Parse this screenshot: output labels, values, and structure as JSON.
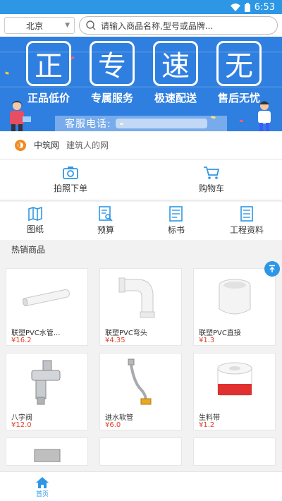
{
  "status": {
    "time": "6:53"
  },
  "search": {
    "city": "北京",
    "placeholder": "请输入商品名称,型号或品牌..."
  },
  "banner": {
    "badges": [
      {
        "char": "正",
        "caption": "正品低价"
      },
      {
        "char": "专",
        "caption": "专属服务"
      },
      {
        "char": "速",
        "caption": "极速配送"
      },
      {
        "char": "无",
        "caption": "售后无忧"
      }
    ],
    "service_label": "客服电话:"
  },
  "brand": {
    "name": "中筑网",
    "slogan": "建筑人的网"
  },
  "actions": [
    {
      "label": "拍照下单"
    },
    {
      "label": "购物车"
    }
  ],
  "nav": [
    {
      "label": "图纸"
    },
    {
      "label": "预算"
    },
    {
      "label": "标书"
    },
    {
      "label": "工程资料"
    }
  ],
  "section": {
    "title": "热销商品"
  },
  "products": [
    {
      "title": "联塑PVC水管...",
      "price": "¥16.2"
    },
    {
      "title": "联塑PVC弯头",
      "price": "¥4.35"
    },
    {
      "title": "联塑PVC直接",
      "price": "¥1.3"
    },
    {
      "title": "八字阀",
      "price": "¥12.0"
    },
    {
      "title": "进水软管",
      "price": "¥6.0"
    },
    {
      "title": "生料带",
      "price": "¥1.2"
    }
  ],
  "tabbar": {
    "home": "首页"
  },
  "colors": {
    "primary": "#2d97e6",
    "price": "#e0402a",
    "banner": "#2f7fe0"
  }
}
